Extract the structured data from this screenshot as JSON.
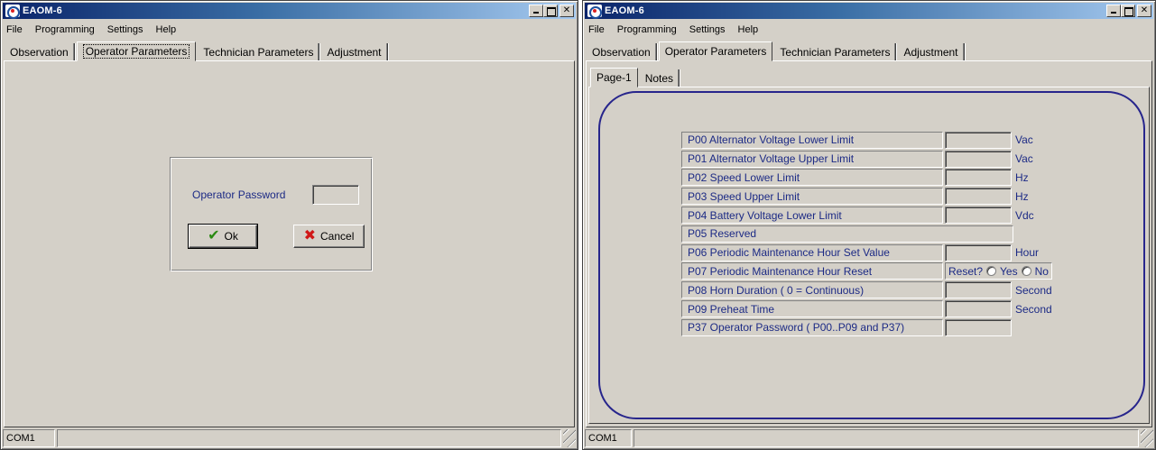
{
  "left_window": {
    "title": "EAOM-6",
    "menu": [
      "File",
      "Programming",
      "Settings",
      "Help"
    ],
    "tabs": [
      "Observation",
      "Operator Parameters",
      "Technician Parameters",
      "Adjustment"
    ],
    "active_tab": "Operator Parameters",
    "dialog": {
      "label": "Operator Password",
      "password_value": "",
      "ok_label": "Ok",
      "cancel_label": "Cancel"
    },
    "status": [
      "COM1",
      ""
    ]
  },
  "right_window": {
    "title": "EAOM-6",
    "menu": [
      "File",
      "Programming",
      "Settings",
      "Help"
    ],
    "tabs": [
      "Observation",
      "Operator Parameters",
      "Technician Parameters",
      "Adjustment"
    ],
    "active_tab": "Operator Parameters",
    "subtabs": [
      "Page-1",
      "Notes"
    ],
    "active_subtab": "Page-1",
    "params": [
      {
        "label": "P00  Alternator Voltage Lower Limit",
        "value": "",
        "unit": "Vac"
      },
      {
        "label": "P01  Alternator Voltage Upper Limit",
        "value": "",
        "unit": "Vac"
      },
      {
        "label": "P02  Speed Lower Limit",
        "value": "",
        "unit": "Hz"
      },
      {
        "label": "P03  Speed Upper Limit",
        "value": "",
        "unit": "Hz"
      },
      {
        "label": "P04  Battery Voltage Lower Limit",
        "value": "",
        "unit": "Vdc"
      },
      {
        "label": "P05  Reserved"
      },
      {
        "label": "P06  Periodic Maintenance Hour Set Value",
        "value": "",
        "unit": "Hour"
      },
      {
        "label": "P07  Periodic Maintenance Hour Reset",
        "reset_prompt": "Reset?",
        "yes_label": "Yes",
        "no_label": "No"
      },
      {
        "label": "P08  Horn Duration ( 0 = Continuous)",
        "value": "",
        "unit": "Second"
      },
      {
        "label": "P09  Preheat Time",
        "value": "",
        "unit": "Second"
      },
      {
        "label": "P37  Operator Password ( P00..P09 and P37)",
        "value": ""
      }
    ],
    "status": [
      "COM1",
      ""
    ]
  },
  "colors": {
    "titlebar_start": "#0a246a",
    "titlebar_end": "#a6caf0",
    "label_blue": "#1c2a85",
    "frame_blue": "#27258c",
    "ok_icon": "#2a8a12",
    "cancel_icon": "#d01818",
    "face": "#d4d0c8"
  },
  "icons": [
    "app-icon",
    "minimize-icon",
    "maximize-icon",
    "close-icon",
    "checkmark-icon",
    "x-icon",
    "size-grip-icon"
  ]
}
